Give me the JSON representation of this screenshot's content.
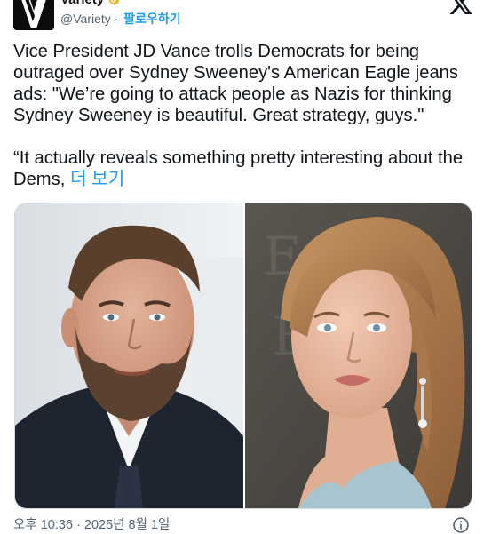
{
  "account": {
    "name": "Variety",
    "handle": "@Variety",
    "separator": " · ",
    "follow_label": "팔로우하기"
  },
  "tweet": {
    "text": "Vice President JD Vance trolls Democrats for being outraged over Sydney Sweeney's American Eagle jeans ads: \"We’re going to attack people as Nazis for thinking Sydney Sweeney is beautiful. Great strategy, guys.\"\n\n“It actually reveals something pretty interesting about the Dems, ",
    "more_label": "더 보기"
  },
  "footer": {
    "timestamp": "오후 10:36 · 2025년 8월 1일"
  },
  "icons": {
    "close": "x-logo-icon",
    "verified": "verified-gold-badge-icon",
    "info": "info-icon"
  },
  "colors": {
    "link": "#1d9bf0",
    "secondary_text": "#536471",
    "verified_gold": "#e8b829"
  }
}
